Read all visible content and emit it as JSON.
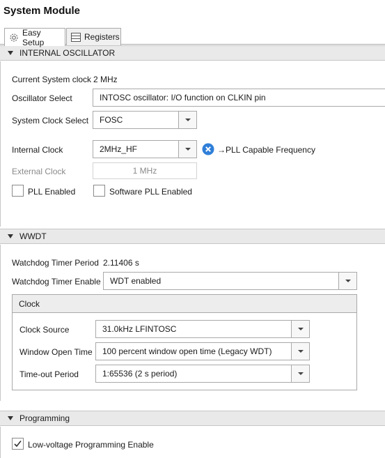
{
  "title": "System Module",
  "tabs": [
    {
      "label": "Easy Setup",
      "icon": "gear-icon"
    },
    {
      "label": "Registers",
      "icon": "table-icon"
    }
  ],
  "internal_oscillator": {
    "header": "INTERNAL OSCILLATOR",
    "current_clock_label": "Current System clock",
    "current_clock_value": "2 MHz",
    "osc_select_label": "Oscillator Select",
    "osc_select_value": "INTOSC oscillator: I/O function on CLKIN pin",
    "sys_clock_select_label": "System Clock Select",
    "sys_clock_select_value": "FOSC",
    "internal_clock_label": "Internal Clock",
    "internal_clock_value": "2MHz_HF",
    "pll_note": "→PLL Capable Frequency",
    "external_clock_label": "External Clock",
    "external_clock_value": "1 MHz",
    "pll_enabled_label": "PLL Enabled",
    "pll_enabled_checked": false,
    "software_pll_label": "Software PLL Enabled",
    "software_pll_checked": false
  },
  "wwdt": {
    "header": "WWDT",
    "period_label": "Watchdog Timer Period",
    "period_value": "2.11406 s",
    "enable_label": "Watchdog Timer Enable",
    "enable_value": "WDT enabled",
    "clock_group": {
      "header": "Clock",
      "source_label": "Clock Source",
      "source_value": "31.0kHz LFINTOSC",
      "window_label": "Window Open Time",
      "window_value": "100 percent window open time (Legacy WDT)",
      "timeout_label": "Time-out Period",
      "timeout_value": "1:65536 (2 s period)"
    }
  },
  "programming": {
    "header": "Programming",
    "lvp_label": "Low-voltage Programming Enable",
    "lvp_checked": true
  },
  "colors": {
    "info_badge": "#2f7fd8",
    "section_header_bg": "#e9e9e9"
  }
}
